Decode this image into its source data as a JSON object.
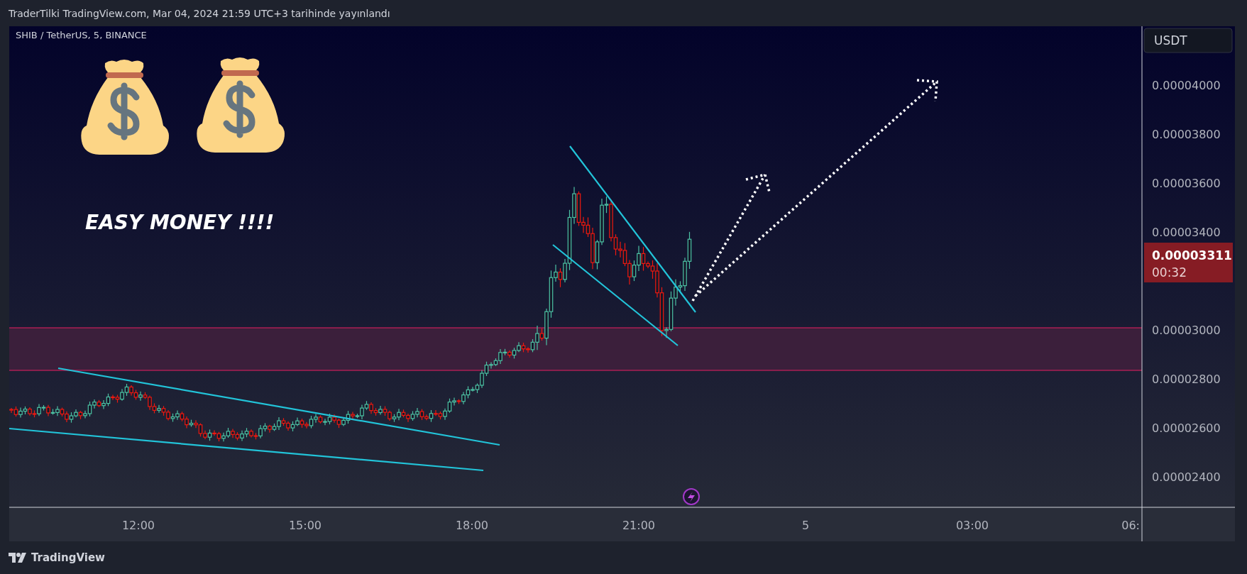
{
  "header": {
    "text": "TraderTilki TradingView.com, Mar 04, 2024 21:59 UTC+3 tarihinde yayınlandı"
  },
  "chart": {
    "symbol": "SHIB / TetherUS, 5, BINANCE",
    "annotation": "EASY MONEY !!!!",
    "currency_button": "USDT",
    "price_labels": [
      "0.00004000",
      "0.00003800",
      "0.00003600",
      "0.00003400",
      "0.00003000",
      "0.00002800",
      "0.00002600",
      "0.00002400"
    ],
    "last_price": {
      "price": "0.00003311",
      "countdown": "00:32"
    },
    "time_labels": [
      "12:00",
      "15:00",
      "18:00",
      "21:00",
      "5",
      "03:00",
      "06:"
    ]
  },
  "footer": {
    "brand": "TradingView"
  }
}
